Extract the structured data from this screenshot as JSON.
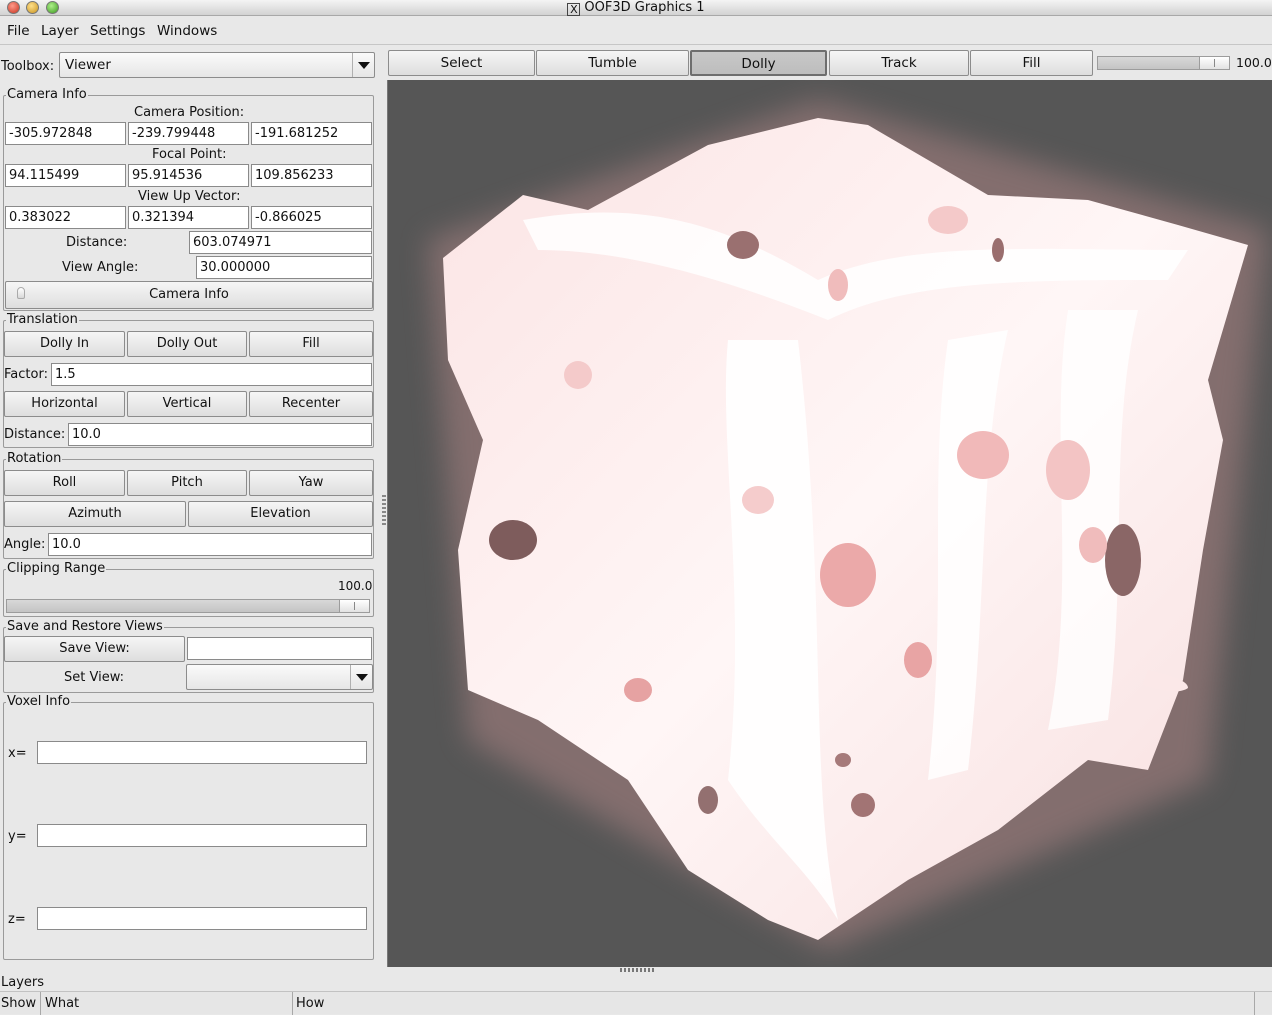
{
  "window": {
    "title": "OOF3D Graphics 1"
  },
  "menubar": [
    "File",
    "Layer",
    "Settings",
    "Windows"
  ],
  "toolbox": {
    "label": "Toolbox:",
    "selected": "Viewer"
  },
  "camera_info": {
    "section": "Camera Info",
    "position_label": "Camera Position:",
    "position": [
      "-305.972848",
      "-239.799448",
      "-191.681252"
    ],
    "focal_label": "Focal Point:",
    "focal": [
      "94.115499",
      "95.914536",
      "109.856233"
    ],
    "viewup_label": "View Up Vector:",
    "viewup": [
      "0.383022",
      "0.321394",
      "-0.866025"
    ],
    "distance_label": "Distance:",
    "distance": "603.074971",
    "angle_label": "View Angle:",
    "angle": "30.000000",
    "button": "Camera Info"
  },
  "translation": {
    "section": "Translation",
    "buttons": [
      "Dolly In",
      "Dolly Out",
      "Fill"
    ],
    "factor_label": "Factor:",
    "factor": "1.5",
    "buttons2": [
      "Horizontal",
      "Vertical",
      "Recenter"
    ],
    "distance_label": "Distance:",
    "distance": "10.0"
  },
  "rotation": {
    "section": "Rotation",
    "buttons": [
      "Roll",
      "Pitch",
      "Yaw"
    ],
    "buttons2": [
      "Azimuth",
      "Elevation"
    ],
    "angle_label": "Angle:",
    "angle": "10.0"
  },
  "clipping": {
    "section": "Clipping Range",
    "value": "100.0",
    "fraction": 1.0
  },
  "views": {
    "section": "Save and Restore Views",
    "save_button": "Save View:",
    "save_value": "",
    "set_label": "Set View:",
    "set_value": ""
  },
  "voxel": {
    "section": "Voxel Info",
    "x_label": "x=",
    "y_label": "y=",
    "z_label": "z=",
    "x": "",
    "y": "",
    "z": ""
  },
  "toolbar": {
    "modes": [
      "Select",
      "Tumble",
      "Dolly",
      "Track",
      "Fill"
    ],
    "active_mode": "Dolly",
    "zoom_value": "100.0",
    "zoom_fraction": 1.0
  },
  "layers": {
    "section": "Layers",
    "columns": [
      "Show",
      "What",
      "How"
    ]
  },
  "colors": {
    "background": "#565656",
    "microstructure": "#fff0f0",
    "pore": "#e8a8a8",
    "shadow": "#8a6a6a"
  }
}
